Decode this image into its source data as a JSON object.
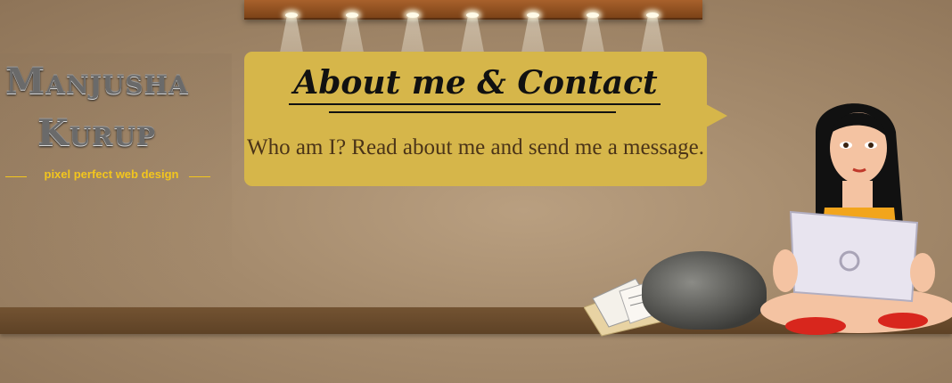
{
  "brand": {
    "name_line1": "Manjusha",
    "name_line2": "Kurup",
    "tagline": "pixel perfect web design"
  },
  "banner": {
    "title": "About me & Contact",
    "subtitle": "Who am I? Read about me and send me a message."
  },
  "colors": {
    "bubble": "#d6b64a",
    "tagline": "#f3c61d",
    "background": "#a48a6c",
    "shelf": "#6b4c2e"
  },
  "illustration": {
    "laptop_icon": "laptop-icon",
    "bag_icon": "bag-icon",
    "papers_icon": "papers-icon"
  }
}
